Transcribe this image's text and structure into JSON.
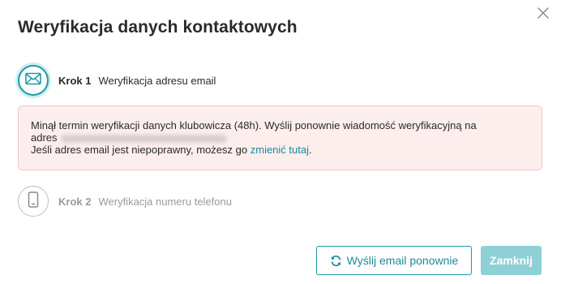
{
  "dialog": {
    "title": "Weryfikacja danych kontaktowych"
  },
  "steps": [
    {
      "number": "Krok 1",
      "label": "Weryfikacja adresu email",
      "icon": "envelope-icon",
      "state": "active"
    },
    {
      "number": "Krok 2",
      "label": "Weryfikacja numeru telefonu",
      "icon": "phone-icon",
      "state": "inactive"
    }
  ],
  "alert": {
    "line1": "Minął termin weryfikacji danych klubowicza (48h). Wyślij ponownie wiadomość weryfikacyjną na",
    "line2_prefix": "adres",
    "line3_prefix": "Jeśli adres email jest niepoprawny, możesz go",
    "link_text": "zmienić tutaj",
    "line3_suffix": "."
  },
  "buttons": {
    "resend_label": "Wyślij email ponownie",
    "close_label": "Zamknij"
  },
  "colors": {
    "accent": "#1a9aa3",
    "link": "#1a8a94",
    "alert_bg": "#fdeeee",
    "alert_border": "#f3c4c6",
    "disabled_button": "#8fd0d6"
  }
}
